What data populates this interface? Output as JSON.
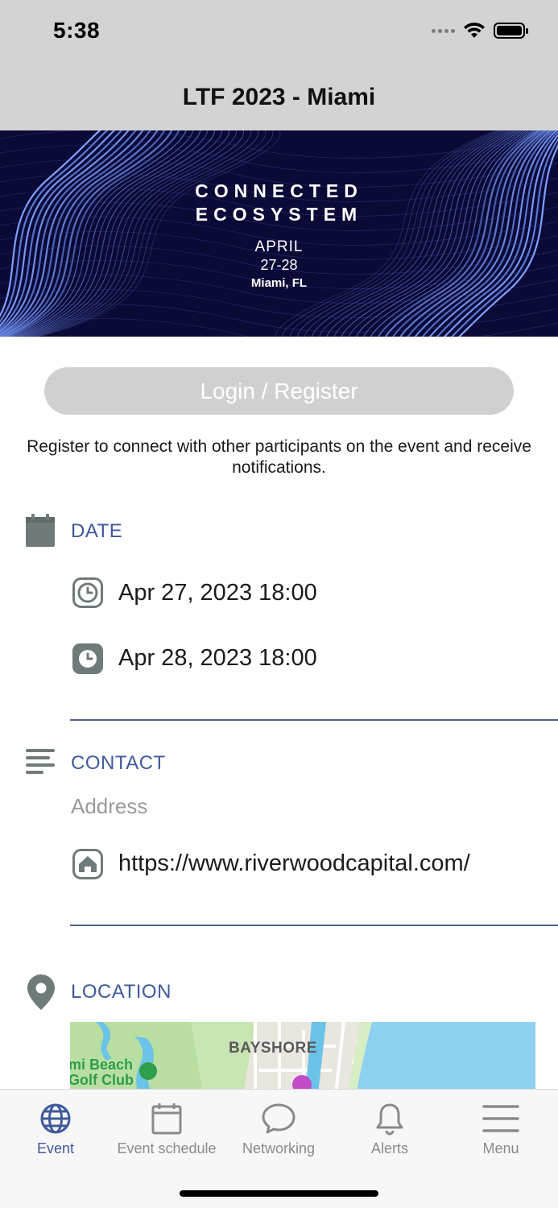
{
  "status_bar": {
    "time": "5:38"
  },
  "header": {
    "title": "LTF 2023 - Miami"
  },
  "banner": {
    "line1": "CONNECTED",
    "line2": "ECOSYSTEM",
    "month": "APRIL",
    "days": "27-28",
    "city": "Miami, FL"
  },
  "login": {
    "button_label": "Login / Register",
    "note": "Register to connect with other participants on the event and receive notifications."
  },
  "date_section": {
    "title": "DATE",
    "start": "Apr 27, 2023 18:00",
    "end": "Apr 28, 2023 18:00"
  },
  "contact_section": {
    "title": "CONTACT",
    "address_label": "Address",
    "website": "https://www.riverwoodcapital.com/"
  },
  "location_section": {
    "title": "LOCATION",
    "map_labels": {
      "area": "BAYSHORE",
      "golf_line1": "mi Beach",
      "golf_line2": "Golf Club"
    }
  },
  "tabbar": {
    "tabs": [
      {
        "label": "Event",
        "icon": "globe-icon",
        "active": true
      },
      {
        "label": "Event schedule",
        "icon": "calendar-icon",
        "active": false
      },
      {
        "label": "Networking",
        "icon": "chat-bubble-icon",
        "active": false
      },
      {
        "label": "Alerts",
        "icon": "bell-icon",
        "active": false
      },
      {
        "label": "Menu",
        "icon": "hamburger-menu-icon",
        "active": false
      }
    ]
  },
  "colors": {
    "accent": "#3f5a9a",
    "header_bg": "#d3d3d3",
    "icon_gray": "#6f7a7a",
    "login_bg": "#d0d0d0",
    "banner_bg": "#0c0a3a"
  }
}
